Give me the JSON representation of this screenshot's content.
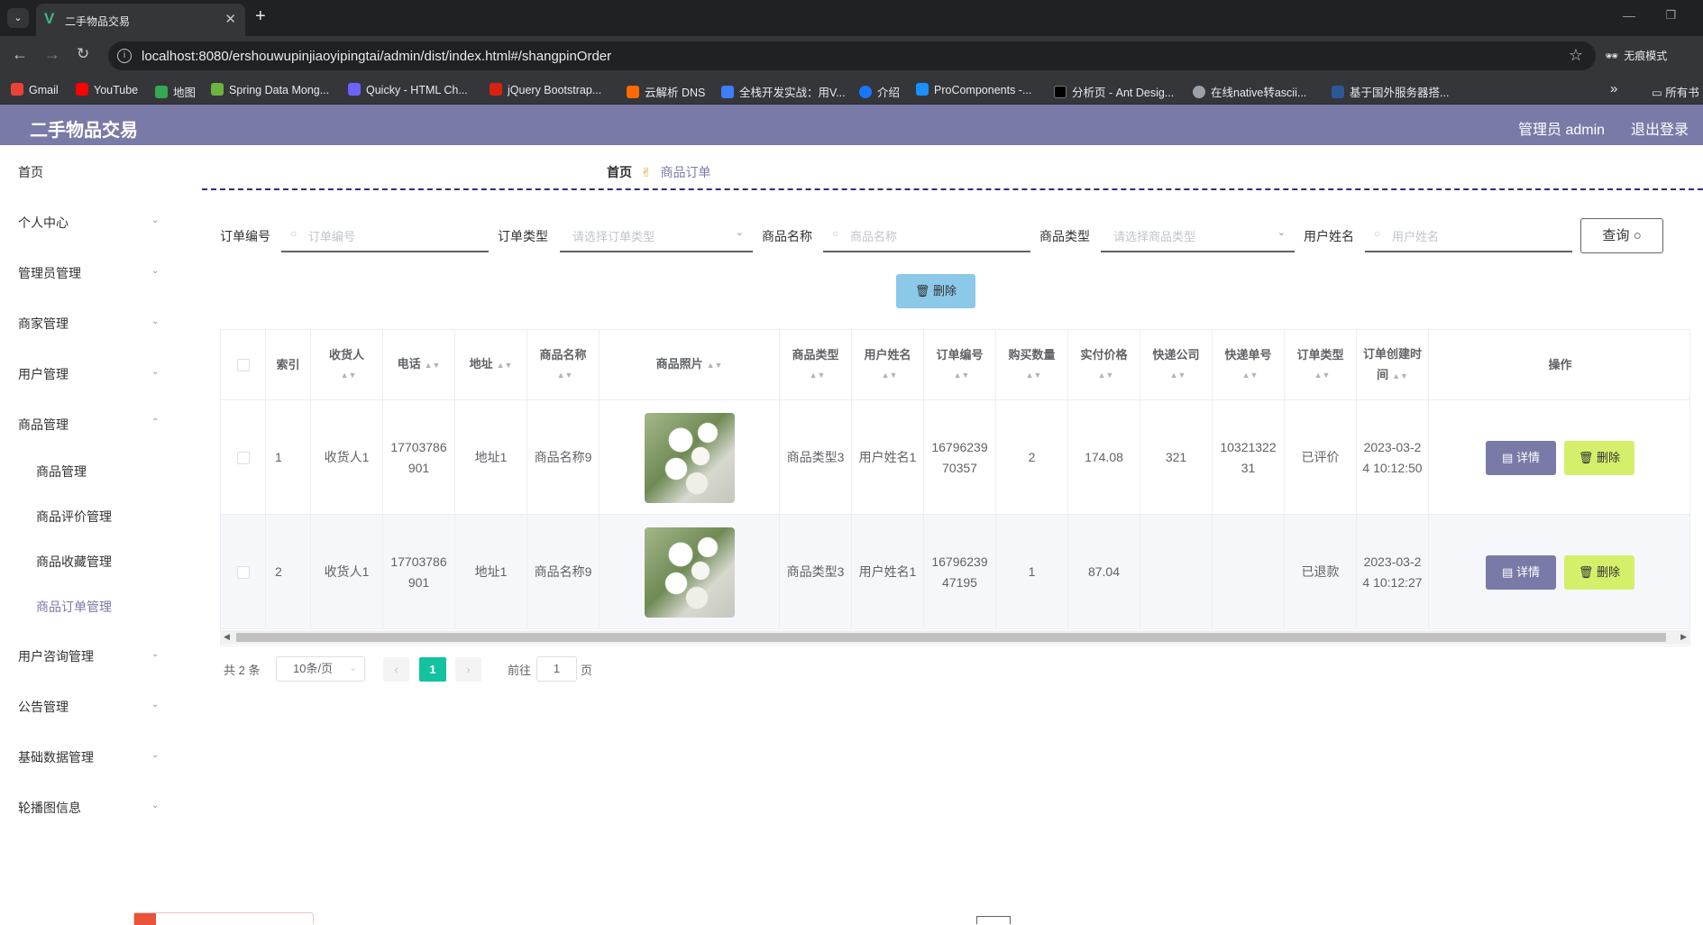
{
  "browser": {
    "tab_title": "二手物品交易",
    "url": "localhost:8080/ershouwupinjiaoyipingtai/admin/dist/index.html#/shangpinOrder",
    "incognito_label": "无痕模式",
    "bookmarks": [
      {
        "label": "Gmail",
        "color": "#ea4335"
      },
      {
        "label": "YouTube",
        "color": "#ff0000"
      },
      {
        "label": "地图",
        "color": "#34a853"
      },
      {
        "label": "Spring Data Mong...",
        "color": "#6db33f"
      },
      {
        "label": "Quicky - HTML Ch...",
        "color": "#6c63ff"
      },
      {
        "label": "jQuery Bootstrap...",
        "color": "#d9230f"
      },
      {
        "label": "云解析 DNS",
        "color": "#ff6a00"
      },
      {
        "label": "全栈开发实战：用V...",
        "color": "#3f7ef8"
      },
      {
        "label": "介绍",
        "color": "#1677ff"
      },
      {
        "label": "ProComponents -...",
        "color": "#1890ff"
      },
      {
        "label": "分析页 - Ant Desig...",
        "color": "#000000"
      },
      {
        "label": "在线native转ascii...",
        "color": "#9aa0a6"
      },
      {
        "label": "基于国外服务器搭...",
        "color": "#2b5797"
      }
    ],
    "bookmarks_all": "所有书"
  },
  "header": {
    "title": "二手物品交易",
    "admin_label": "管理员 admin",
    "logout_label": "退出登录"
  },
  "sidebar": {
    "home": "首页",
    "items": [
      "个人中心",
      "管理员管理",
      "商家管理",
      "用户管理",
      "商品管理"
    ],
    "sub_items": [
      "商品管理",
      "商品评价管理",
      "商品收藏管理",
      "商品订单管理"
    ],
    "items_after": [
      "用户咨询管理",
      "公告管理",
      "基础数据管理",
      "轮播图信息"
    ]
  },
  "breadcrumb": {
    "home": "首页",
    "current": "商品订单"
  },
  "filters": {
    "order_no_label": "订单编号",
    "order_no_placeholder": "订单编号",
    "order_type_label": "订单类型",
    "order_type_placeholder": "请选择订单类型",
    "product_name_label": "商品名称",
    "product_name_placeholder": "商品名称",
    "product_type_label": "商品类型",
    "product_type_placeholder": "请选择商品类型",
    "user_name_label": "用户姓名",
    "user_name_placeholder": "用户姓名",
    "query_label": "查询"
  },
  "batch_delete_label": "删除",
  "table": {
    "headers": {
      "index": "索引",
      "receiver": "收货人",
      "phone": "电话",
      "address": "地址",
      "product_name": "商品名称",
      "product_photo": "商品照片",
      "product_type": "商品类型",
      "user_name": "用户姓名",
      "order_no": "订单编号",
      "quantity": "购买数量",
      "paid": "实付价格",
      "courier": "快递公司",
      "tracking_no": "快递单号",
      "order_type": "订单类型",
      "created": "订单创建时间",
      "actions": "操作"
    },
    "rows": [
      {
        "index": "1",
        "receiver": "收货人1",
        "phone": "17703786901",
        "address": "地址1",
        "product_name": "商品名称9",
        "product_type": "商品类型3",
        "user_name": "用户姓名1",
        "order_no": "1679623970357",
        "quantity": "2",
        "paid": "174.08",
        "courier": "321",
        "tracking_no": "1032132231",
        "order_type": "已评价",
        "created": "2023-03-24 10:12:50",
        "detail_label": "详情",
        "delete_label": "删除"
      },
      {
        "index": "2",
        "receiver": "收货人1",
        "phone": "17703786901",
        "address": "地址1",
        "product_name": "商品名称9",
        "product_type": "商品类型3",
        "user_name": "用户姓名1",
        "order_no": "1679623947195",
        "quantity": "1",
        "paid": "87.04",
        "courier": "",
        "tracking_no": "",
        "order_type": "已退款",
        "created": "2023-03-24 10:12:27",
        "detail_label": "详情",
        "delete_label": "删除"
      }
    ]
  },
  "pagination": {
    "total": "共 2 条",
    "page_size": "10条/页",
    "current_page": "1",
    "goto_label": "前往",
    "goto_value": "1",
    "page_suffix": "页"
  },
  "colors": {
    "header_bg": "#7a7aa8",
    "detail_button": "#7a7aa8",
    "delete_button": "#d4f06a",
    "batch_delete": "#8cc8e8",
    "pager_active": "#13c2a0"
  }
}
